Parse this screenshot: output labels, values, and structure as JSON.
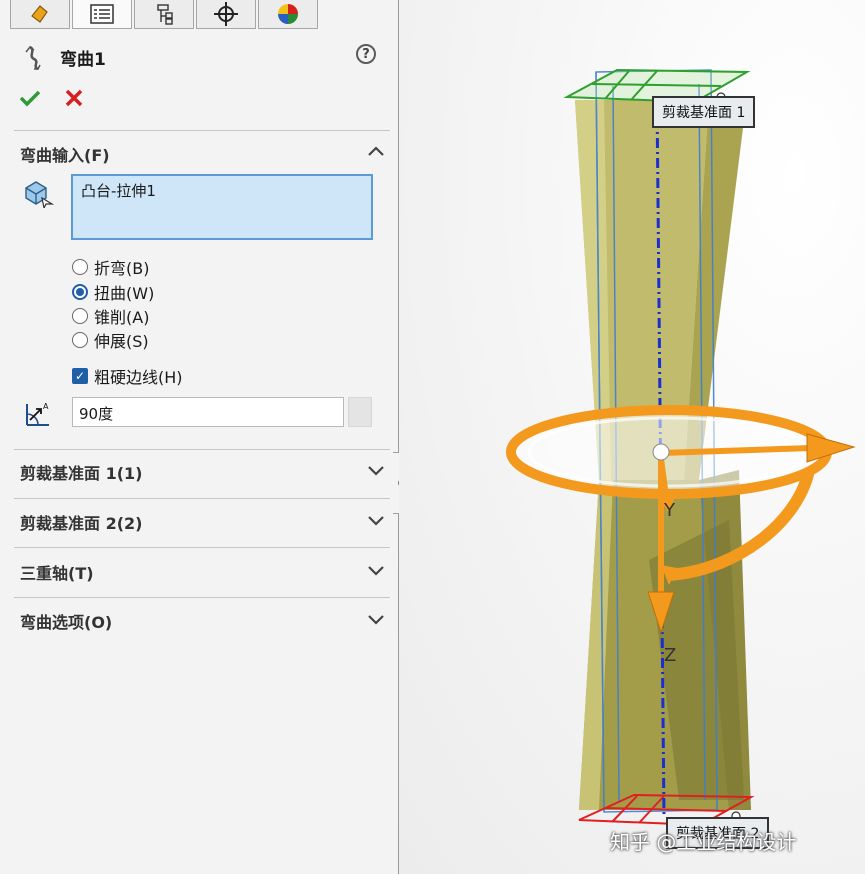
{
  "tabs": [
    {
      "name": "feature-manager",
      "icon": "feature-tree-icon"
    },
    {
      "name": "property-manager",
      "icon": "property-list-icon"
    },
    {
      "name": "configuration-manager",
      "icon": "configuration-icon"
    },
    {
      "name": "dimxpert-manager",
      "icon": "crosshair-icon"
    },
    {
      "name": "display-manager",
      "icon": "appearance-sphere-icon"
    }
  ],
  "feature": {
    "title": "弯曲1",
    "help_label": "?"
  },
  "sections": {
    "bend_input": {
      "label": "弯曲输入(F)",
      "entity": "凸台-拉伸1"
    },
    "trim_plane_1": {
      "label": "剪裁基准面 1(1)"
    },
    "trim_plane_2": {
      "label": "剪裁基准面 2(2)"
    },
    "triad": {
      "label": "三重轴(T)"
    },
    "bend_options": {
      "label": "弯曲选项(O)"
    }
  },
  "bend_types": [
    {
      "label": "折弯(B)",
      "selected": false
    },
    {
      "label": "扭曲(W)",
      "selected": true
    },
    {
      "label": "锥削(A)",
      "selected": false
    },
    {
      "label": "伸展(S)",
      "selected": false
    }
  ],
  "hard_edges": {
    "label": "粗硬边线(H)",
    "checked": true,
    "check_glyph": "✓"
  },
  "angle": {
    "value": "90度"
  },
  "viewport": {
    "callout_top": "剪裁基准面 1",
    "callout_bottom": "剪裁基准面 2",
    "axis_y": "Y",
    "axis_z": "Z",
    "watermark": "知乎 @工业结构设计"
  },
  "colors": {
    "accent": "#1f5fa8",
    "ok": "#2e9b3a",
    "cancel": "#d62020",
    "triad": "#f39a1e",
    "body": "#b9b25e",
    "plane_top": "#2da02d",
    "plane_bottom": "#e02020",
    "axis_line": "#1a2fd0"
  }
}
